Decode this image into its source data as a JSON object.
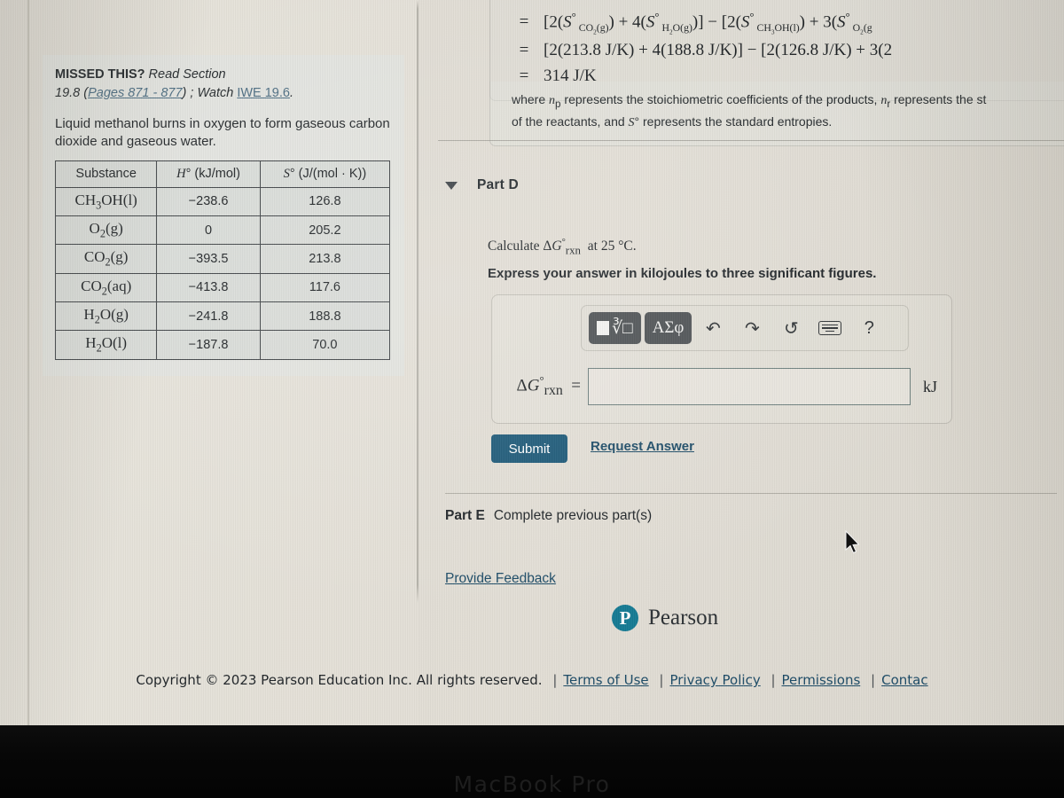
{
  "left_panel": {
    "missed_label": "MISSED THIS?",
    "read_section": "Read Section",
    "section_number": "19.8",
    "pages_link": "Pages 871 - 877",
    "watch_label": "Watch",
    "iwe_link": "IWE 19.6",
    "prompt": "Liquid methanol burns in oxygen to form gaseous carbon dioxide and gaseous water.",
    "table": {
      "headers": [
        "Substance",
        "H° (kJ/mol)",
        "S° (J/(mol · K))"
      ],
      "rows": [
        {
          "substance": "CH3OH(l)",
          "h": "−238.6",
          "s": "126.8"
        },
        {
          "substance": "O2(g)",
          "h": "0",
          "s": "205.2"
        },
        {
          "substance": "CO2(g)",
          "h": "−393.5",
          "s": "213.8"
        },
        {
          "substance": "CO2(aq)",
          "h": "−413.8",
          "s": "117.6"
        },
        {
          "substance": "H2O(g)",
          "h": "−241.8",
          "s": "188.8"
        },
        {
          "substance": "H2O(l)",
          "h": "−187.8",
          "s": "70.0"
        }
      ]
    }
  },
  "derivation": {
    "line1_sign": "=",
    "line1": "[2(S° CO2(g)) + 4(S° H2O(g))] − [2(S° CH3OH(l)) + 3(S° O2(g",
    "line2_sign": "=",
    "line2": "[2(213.8 J/K) + 4(188.8 J/K)] − [2(126.8 J/K) + 3(2",
    "line3_sign": "=",
    "line3": "314 J/K",
    "where_text": "where np represents the stoichiometric coefficients of the products, nr represents the st of the reactants, and S° represents the standard entropies."
  },
  "part_d": {
    "title": "Part D",
    "question": "Calculate ΔG°rxn at 25 °C.",
    "instruction": "Express your answer in kilojoules to three significant figures.",
    "toolbar": {
      "template_button": "template-sqrt",
      "greek_button": "ΑΣφ",
      "undo": "↶",
      "redo": "↷",
      "reset": "↺",
      "keyboard": "keyboard",
      "help": "?"
    },
    "answer_label": "ΔG°rxn  =",
    "answer_value": "",
    "answer_placeholder": "",
    "answer_unit": "kJ",
    "submit_label": "Submit",
    "request_answer_label": "Request Answer"
  },
  "part_e": {
    "label": "Part E",
    "status": "Complete previous part(s)"
  },
  "feedback_link": "Provide Feedback",
  "brand": {
    "logo_letter": "P",
    "name": "Pearson"
  },
  "footer": {
    "copyright": "Copyright © 2023 Pearson Education Inc. All rights reserved.",
    "links": [
      "Terms of Use",
      "Privacy Policy",
      "Permissions",
      "Contac"
    ]
  },
  "device": {
    "label": "MacBook Pro"
  },
  "colors": {
    "submit_bg": "#1b5877",
    "link": "#1b4a66",
    "pearson_teal": "#157a93",
    "screen_bg": "#e0dcd3"
  }
}
